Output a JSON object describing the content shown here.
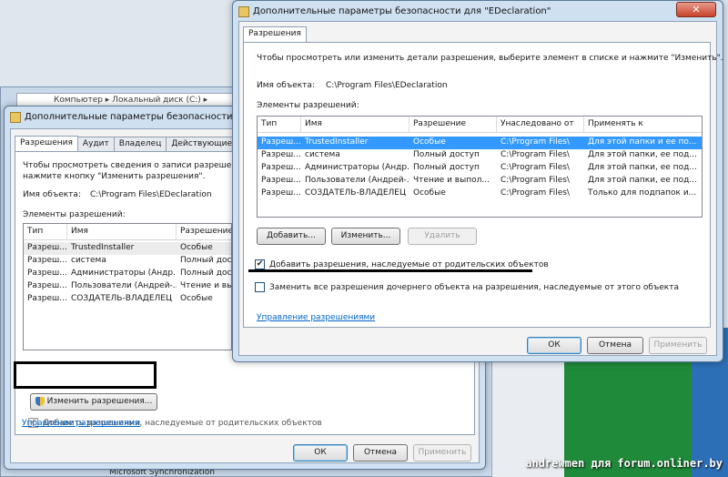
{
  "background": {
    "address": "Компьютер ▸ Локальный диск (C:) ▸",
    "bottom_item": "Microsoft Synchronization"
  },
  "back_dialog": {
    "title": "Дополнительные параметры безопасности для \"E...",
    "tabs": [
      "Разрешения",
      "Аудит",
      "Владелец",
      "Действующие разре"
    ],
    "info_line1": "Чтобы просмотреть сведения о записи разрешения, д",
    "info_line2": "нажмите кнопку \"Изменить разрешения\".",
    "object_label": "Имя объекта:",
    "object_value": "C:\\Program Files\\EDeclaration",
    "entries_label": "Элементы разрешений:",
    "columns": [
      "Тип",
      "Имя",
      "Разрешение"
    ],
    "rows": [
      [
        "Разреш...",
        "TrustedInstaller",
        "Особые"
      ],
      [
        "Разреш...",
        "система",
        "Полный досту"
      ],
      [
        "Разреш...",
        "Администраторы (Андр...",
        "Полный досту"
      ],
      [
        "Разреш...",
        "Пользователи (Андрей-...",
        "Чтение и вып"
      ],
      [
        "Разреш...",
        "СОЗДАТЕЛЬ-ВЛАДЕЛЕЦ",
        "Особые"
      ]
    ],
    "change_button": "Изменить разрешения...",
    "inherit_label": "Добавить разрешения, наследуемые от родительских объектов",
    "manage_link": "Управление разрешениями",
    "ok": "ОК",
    "cancel": "Отмена",
    "apply": "Применить"
  },
  "front_dialog": {
    "title": "Дополнительные параметры безопасности  для \"EDeclaration\"",
    "tab": "Разрешения",
    "info": "Чтобы просмотреть или изменить детали разрешения, выберите элемент в списке и нажмите \"Изменить\".",
    "object_label": "Имя объекта:",
    "object_value": "C:\\Program Files\\EDeclaration",
    "entries_label": "Элементы разрешений:",
    "columns": [
      "Тип",
      "Имя",
      "Разрешение",
      "Унаследовано от",
      "Применять к"
    ],
    "rows": [
      [
        "Разреш...",
        "TrustedInstaller",
        "Особые",
        "C:\\Program Files\\",
        "Для этой папки и ее по..."
      ],
      [
        "Разреш...",
        "система",
        "Полный доступ",
        "C:\\Program Files\\",
        "Для этой папки, ее под..."
      ],
      [
        "Разреш...",
        "Администраторы (Андр...",
        "Полный доступ",
        "C:\\Program Files\\",
        "Для этой папки, ее под..."
      ],
      [
        "Разреш...",
        "Пользователи (Андрей-...",
        "Чтение и выпол...",
        "C:\\Program Files\\",
        "Для этой папки, ее под..."
      ],
      [
        "Разреш...",
        "СОЗДАТЕЛЬ-ВЛАДЕЛЕЦ",
        "Особые",
        "C:\\Program Files\\",
        "Только для подпапок и..."
      ]
    ],
    "add": "Добавить...",
    "change": "Изменить...",
    "remove": "Удалить",
    "inherit_label": "Добавить разрешения, наследуемые от родительских объектов",
    "inherit_checked": "✔",
    "replace_label": "Заменить все разрешения дочернего объекта на разрешения, наследуемые от этого объекта",
    "manage_link": "Управление разрешениями",
    "ok": "ОК",
    "cancel": "Отмена",
    "apply": "Применить",
    "close_glyph": "✕"
  },
  "watermark": "andrewmen для forum.onliner.by",
  "colors": {
    "selection": "#3399ff",
    "link": "#0066cc",
    "highlight": "#000000"
  }
}
